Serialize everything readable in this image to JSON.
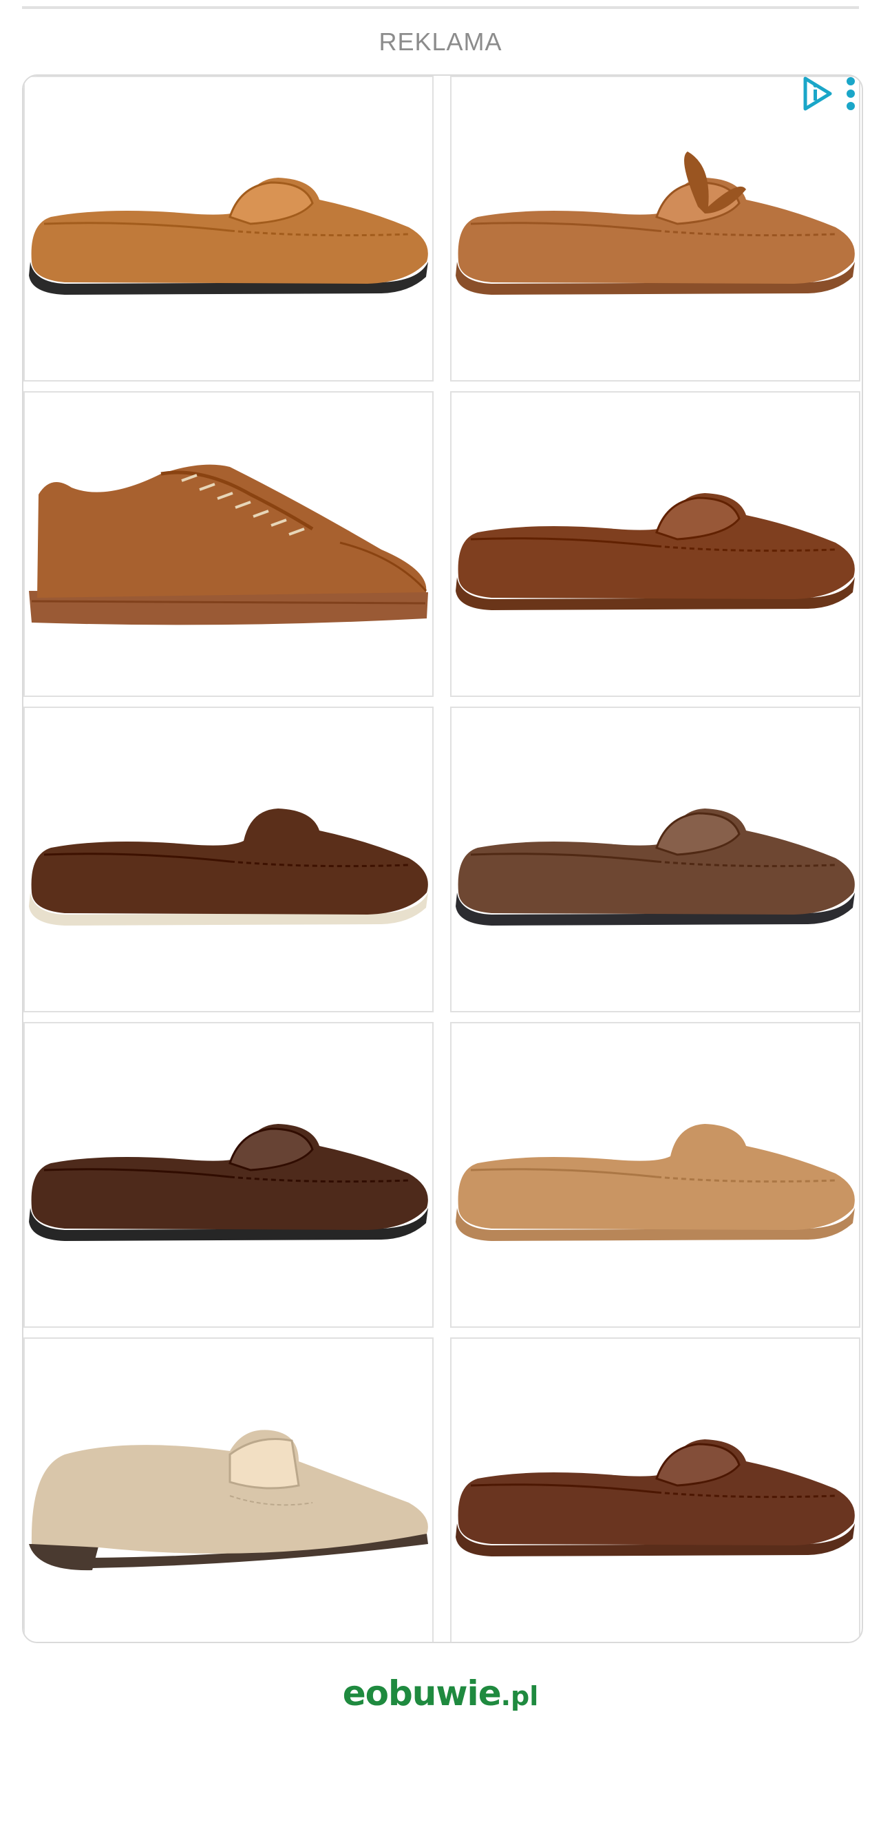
{
  "ad": {
    "label": "REKLAMA",
    "adchoices_icon": "adchoices-icon",
    "menu_icon": "more-vertical-icon",
    "accent_color": "#1aa6c8"
  },
  "products": [
    {
      "name": "tan suede penny loafer",
      "upper": "#c07a3a",
      "sole": "#2a2a2a",
      "style": "penny"
    },
    {
      "name": "tan suede driving moccasin with bow",
      "upper": "#b8733f",
      "sole": "#8a4f2a",
      "style": "bow"
    },
    {
      "name": "brown leather lace-up sneaker",
      "upper": "#a8612f",
      "sole": "#9a5a35",
      "style": "sneaker"
    },
    {
      "name": "brown leather penny loafer",
      "upper": "#7f3f1f",
      "sole": "#6a3519",
      "style": "penny"
    },
    {
      "name": "dark brown suede loafer cream sole",
      "upper": "#5b2f1a",
      "sole": "#e8e0cd",
      "style": "slip"
    },
    {
      "name": "brown suede penny loafer dark sole",
      "upper": "#6e4732",
      "sole": "#2c2c30",
      "style": "penny"
    },
    {
      "name": "dark brown leather loafer",
      "upper": "#4e2a1b",
      "sole": "#262626",
      "style": "penny"
    },
    {
      "name": "light tan leather moccasin",
      "upper": "#c99563",
      "sole": "#b88658",
      "style": "slip"
    },
    {
      "name": "beige suede penny loafer with heel",
      "upper": "#d9c6aa",
      "sole": "#4a3a30",
      "style": "heel"
    },
    {
      "name": "brown suede driving loafer",
      "upper": "#6a3520",
      "sole": "#5a2d1a",
      "style": "penny"
    }
  ],
  "brand": {
    "main": "eobuwie",
    "tld": ".pl",
    "color": "#1f8a3f"
  }
}
